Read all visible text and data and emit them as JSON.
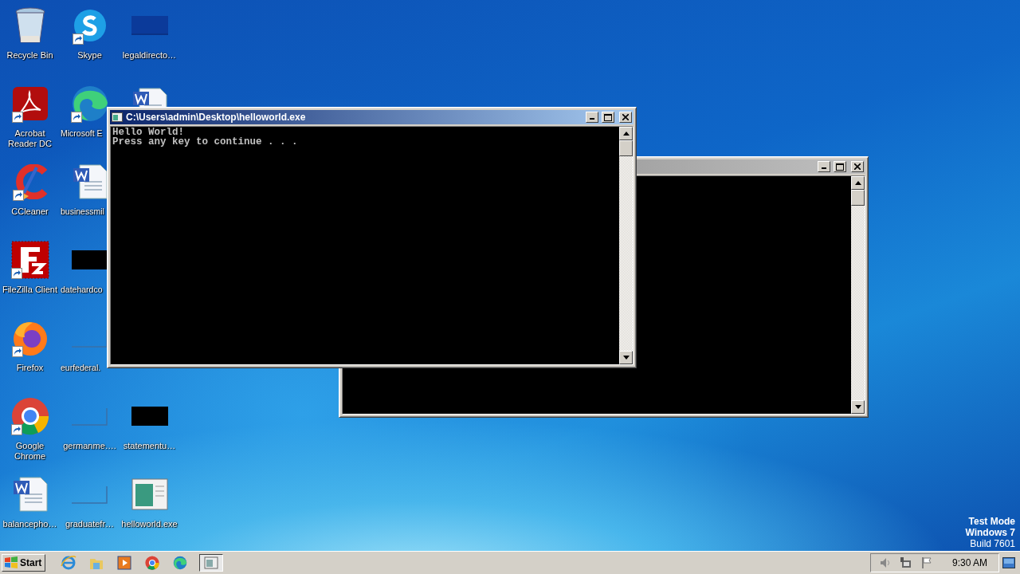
{
  "desktop": {
    "columns": [
      {
        "icons": [
          {
            "kind": "recycle-bin",
            "label": "Recycle Bin"
          },
          {
            "kind": "pdf",
            "label": "Acrobat Reader DC",
            "shortcut": true
          },
          {
            "kind": "ccleaner",
            "label": "CCleaner",
            "shortcut": true
          },
          {
            "kind": "filezilla",
            "label": "FileZilla Client",
            "shortcut": true
          },
          {
            "kind": "firefox",
            "label": "Firefox",
            "shortcut": true
          },
          {
            "kind": "chrome",
            "label": "Google Chrome",
            "shortcut": true
          },
          {
            "kind": "word",
            "label": "balancepho…"
          }
        ]
      },
      {
        "icons": [
          {
            "kind": "skype",
            "label": "Skype",
            "shortcut": true
          },
          {
            "kind": "edge",
            "label": "Microsoft E",
            "shortcut": true,
            "cut_off": true
          },
          {
            "kind": "word",
            "label": "businessmil",
            "cut_off": true
          },
          {
            "kind": "black",
            "label": "datehardco",
            "cut_off": true
          },
          {
            "kind": "blank",
            "label": "eurfederal.",
            "cut_off": true
          },
          {
            "kind": "blank",
            "label": "germanme…."
          },
          {
            "kind": "blank",
            "label": "graduatefr…"
          }
        ]
      },
      {
        "icons": [
          {
            "kind": "dark",
            "label": "legaldirecto…"
          },
          {
            "kind": "word",
            "cut_off": true
          },
          {
            "kind": "covered"
          },
          {
            "kind": "covered"
          },
          {
            "kind": "covered"
          },
          {
            "kind": "black",
            "label": "statementu…"
          },
          {
            "kind": "exe",
            "label": "helloworld.exe"
          }
        ]
      }
    ]
  },
  "windows": [
    {
      "active": false
    },
    {
      "title": "C:\\Users\\admin\\Desktop\\helloworld.exe",
      "active": true,
      "lines": [
        "Hello World!",
        "Press any key to continue . . ."
      ]
    }
  ],
  "system_notice": [
    "Test Mode",
    "Windows 7",
    "Build 7601"
  ],
  "taskbar": {
    "start": "Start",
    "apps": [
      {
        "kind": "ie",
        "selected": false
      },
      {
        "kind": "explorer",
        "selected": false
      },
      {
        "kind": "media",
        "selected": false
      },
      {
        "kind": "chrome",
        "selected": false
      },
      {
        "kind": "edge",
        "selected": false
      },
      {
        "kind": "console",
        "selected": true
      }
    ],
    "clock": "9:30 AM"
  }
}
